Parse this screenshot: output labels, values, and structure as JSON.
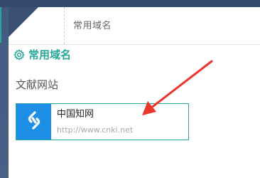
{
  "header": {
    "title": "常用域名"
  },
  "section": {
    "title": "常用域名",
    "icon": "gear-icon"
  },
  "categories": [
    {
      "label": "文献网站",
      "sites": [
        {
          "name": "中国知网",
          "url": "http://www.cnki.net",
          "icon": "link-icon",
          "icon_bg": "#1e8fe6"
        }
      ]
    }
  ],
  "colors": {
    "accent": "#2aa79c",
    "annotation_arrow": "#e8352e",
    "background": "#415a80"
  }
}
